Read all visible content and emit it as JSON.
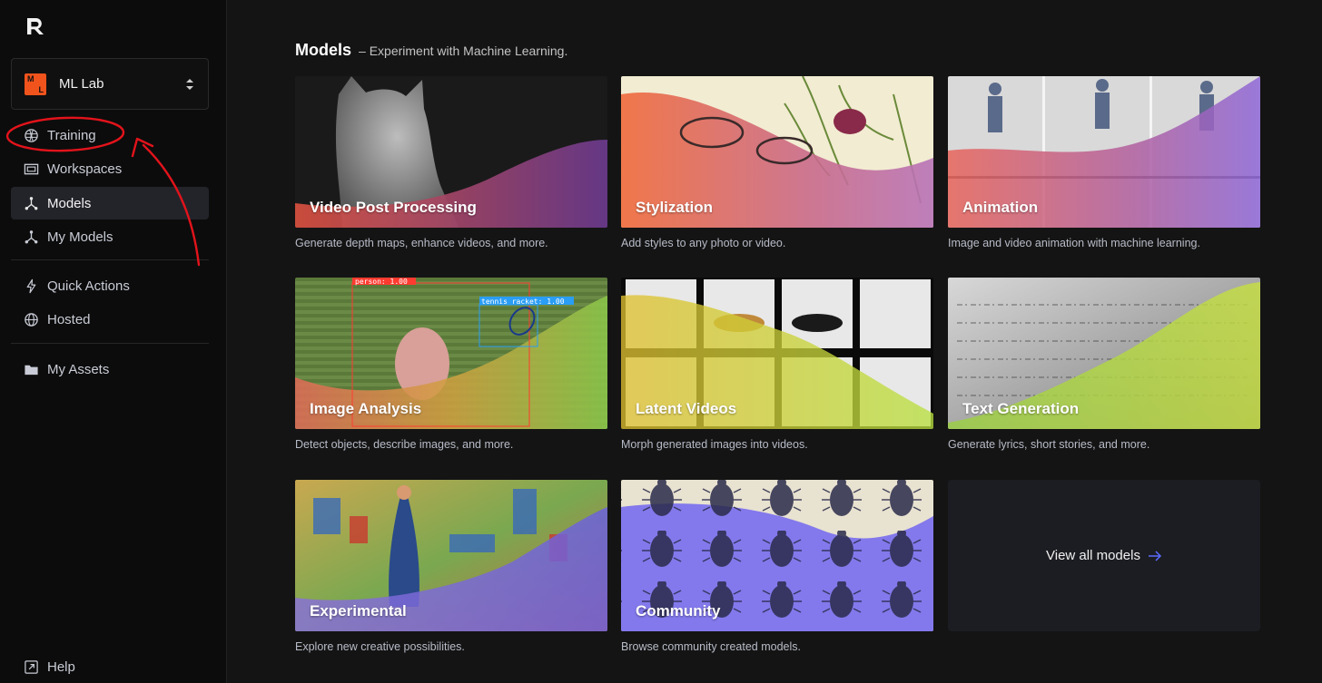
{
  "sidebar": {
    "workspace": {
      "name": "ML Lab",
      "avatar_letters": [
        "M",
        "L"
      ],
      "avatar_color": "#f0531c"
    },
    "nav_primary": [
      {
        "label": "Training",
        "icon": "training-icon",
        "active": false
      },
      {
        "label": "Workspaces",
        "icon": "workspaces-icon",
        "active": false
      },
      {
        "label": "Models",
        "icon": "models-icon",
        "active": true
      },
      {
        "label": "My Models",
        "icon": "models-icon",
        "active": false
      }
    ],
    "nav_secondary": [
      {
        "label": "Quick Actions",
        "icon": "lightning-icon"
      },
      {
        "label": "Hosted",
        "icon": "globe-icon"
      }
    ],
    "nav_tertiary": [
      {
        "label": "My Assets",
        "icon": "folder-icon"
      }
    ],
    "help_label": "Help"
  },
  "main": {
    "title": "Models",
    "subtitle": "– Experiment with Machine Learning.",
    "cards": [
      {
        "title": "Video Post Processing",
        "desc": "Generate depth maps, enhance videos, and more."
      },
      {
        "title": "Stylization",
        "desc": "Add styles to any photo or video."
      },
      {
        "title": "Animation",
        "desc": "Image and video animation with machine learning."
      },
      {
        "title": "Image Analysis",
        "desc": "Detect objects, describe images, and more."
      },
      {
        "title": "Latent Videos",
        "desc": "Morph generated images into videos."
      },
      {
        "title": "Text Generation",
        "desc": "Generate lyrics, short stories, and more."
      },
      {
        "title": "Experimental",
        "desc": "Explore new creative possibilities."
      },
      {
        "title": "Community",
        "desc": "Browse community created models."
      }
    ],
    "view_all_label": "View all models",
    "detection_labels": [
      "person: 1.00",
      "tennis racket: 1.00"
    ]
  },
  "colors": {
    "accent": "#5b6cff",
    "annotation": "#e3131b"
  }
}
